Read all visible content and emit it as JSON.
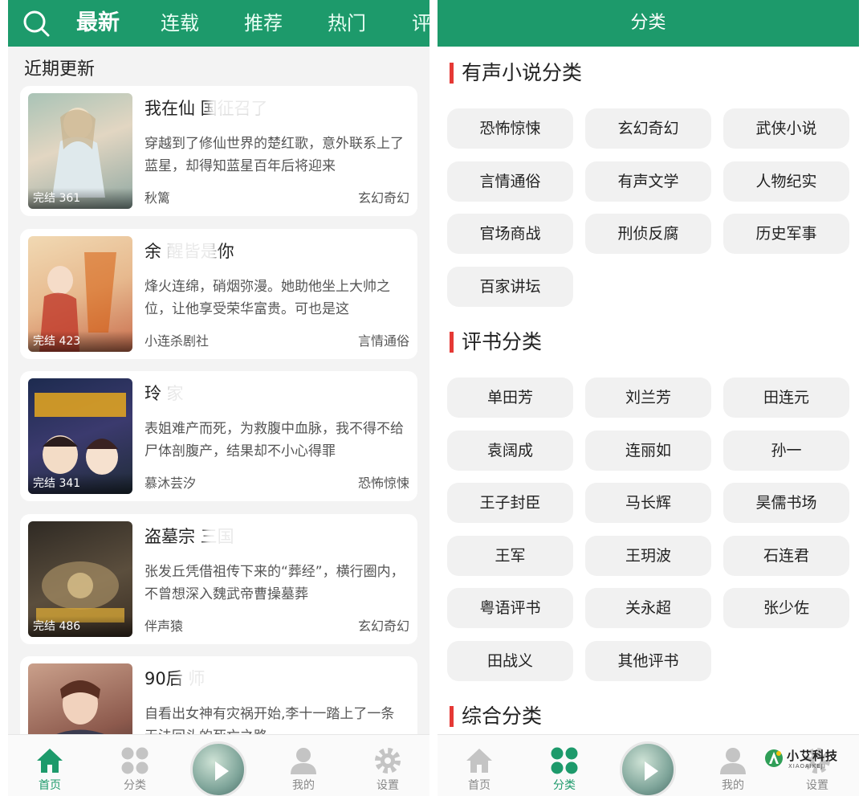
{
  "left": {
    "tabs": [
      {
        "label": "最新",
        "active": true
      },
      {
        "label": "连载",
        "active": false
      },
      {
        "label": "推荐",
        "active": false
      },
      {
        "label": "热门",
        "active": false
      },
      {
        "label": "评",
        "active": false
      }
    ],
    "section_title": "近期更新",
    "books": [
      {
        "title": "我在仙              国征召了",
        "desc": "穿越到了修仙世界的楚红歌，意外联系上了蓝星，却得知蓝星百年后将迎来",
        "author": "秋篱",
        "category": "玄幻奇幻",
        "badge": "完结 361"
      },
      {
        "title": "余       醒皆是你",
        "desc": "烽火连绵，硝烟弥漫。她助他坐上大帅之位，让他享受荣华富贵。可也是这",
        "author": "小连杀剧社",
        "category": "言情通俗",
        "badge": "完结 423"
      },
      {
        "title": "玲         家",
        "desc": "表姐难产而死，为救腹中血脉，我不得不给尸体剖腹产，结果却不小心得罪",
        "author": "慕沐芸汐",
        "category": "恐怖惊悚",
        "badge": "完结 341"
      },
      {
        "title": "盗墓宗      三国",
        "desc": "张发丘凭借祖传下来的“葬经”，横行圈内，不曾想深入魏武帝曹操墓葬",
        "author": "伴声猿",
        "category": "玄幻奇幻",
        "badge": "完结 486"
      },
      {
        "title": "90后        师",
        "desc": "自看出女神有灾祸开始,李十一踏上了一条无法回头的死亡之路",
        "author": "",
        "category": "",
        "badge": ""
      }
    ],
    "nav": [
      {
        "label": "首页",
        "icon": "home-icon",
        "active": true
      },
      {
        "label": "分类",
        "icon": "grid-icon",
        "active": false
      },
      {
        "label": "我的",
        "icon": "user-icon",
        "active": false
      },
      {
        "label": "设置",
        "icon": "gear-icon",
        "active": false
      }
    ]
  },
  "right": {
    "title": "分类",
    "groups": [
      {
        "label": "有声小说分类",
        "items": [
          "恐怖惊悚",
          "玄幻奇幻",
          "武侠小说",
          "言情通俗",
          "有声文学",
          "人物纪实",
          "官场商战",
          "刑侦反腐",
          "历史军事",
          "百家讲坛"
        ]
      },
      {
        "label": "评书分类",
        "items": [
          "单田芳",
          "刘兰芳",
          "田连元",
          "袁阔成",
          "连丽如",
          "孙一",
          "王子封臣",
          "马长辉",
          "昊儒书场",
          "王军",
          "王玥波",
          "石连君",
          "粤语评书",
          "关永超",
          "张少佐",
          "田战义",
          "其他评书"
        ]
      },
      {
        "label": "综合分类",
        "items": []
      }
    ],
    "nav": [
      {
        "label": "首页",
        "icon": "home-icon",
        "active": false
      },
      {
        "label": "分类",
        "icon": "grid-icon",
        "active": true
      },
      {
        "label": "我的",
        "icon": "user-icon",
        "active": false
      },
      {
        "label": "设置",
        "icon": "gear-icon",
        "active": false
      }
    ]
  },
  "watermark": {
    "name": "小艾科技",
    "sub": "XIAOAIKEJI"
  },
  "colors": {
    "brand": "#1d9a6b",
    "accent": "#e53935",
    "chip_bg": "#f1f1f1"
  }
}
